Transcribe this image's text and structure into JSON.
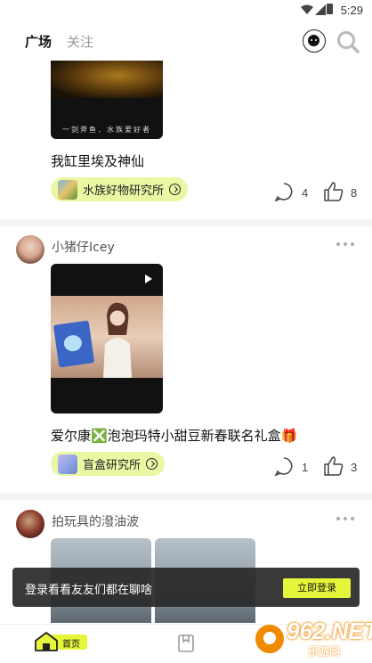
{
  "status_bar": {
    "time": "5:29"
  },
  "header": {
    "tabs": [
      {
        "label": "广场",
        "active": true
      },
      {
        "label": "关注",
        "active": false
      }
    ],
    "message_icon": "message-bubble-icon",
    "search_icon": "search-icon"
  },
  "feed": {
    "posts": [
      {
        "thumbnail_caption": "一剑斧鱼．水族爱好者",
        "title": "我缸里埃及神仙",
        "tag": {
          "label": "水族好物研究所",
          "icon": "fish-tank-icon"
        },
        "comments": "4",
        "likes": "8"
      },
      {
        "username": "小猪仔Icey",
        "title": "爱尔康❎泡泡玛特小甜豆新春联名礼盒🎁",
        "tag": {
          "label": "盲盒研究所",
          "icon": "blind-box-icon"
        },
        "comments": "1",
        "likes": "3"
      },
      {
        "username": "拍玩具的潑油波"
      }
    ]
  },
  "toast": {
    "text": "登录看看友友们都在聊啥",
    "button": "立即登录"
  },
  "bottom_nav": {
    "home_label": "首页"
  },
  "watermark": {
    "text": "962.NET",
    "sub": "乐游网"
  },
  "colors": {
    "accent": "#e4f53a",
    "tag_bg": "#eaf7a3",
    "toast_bg": "#282828"
  }
}
